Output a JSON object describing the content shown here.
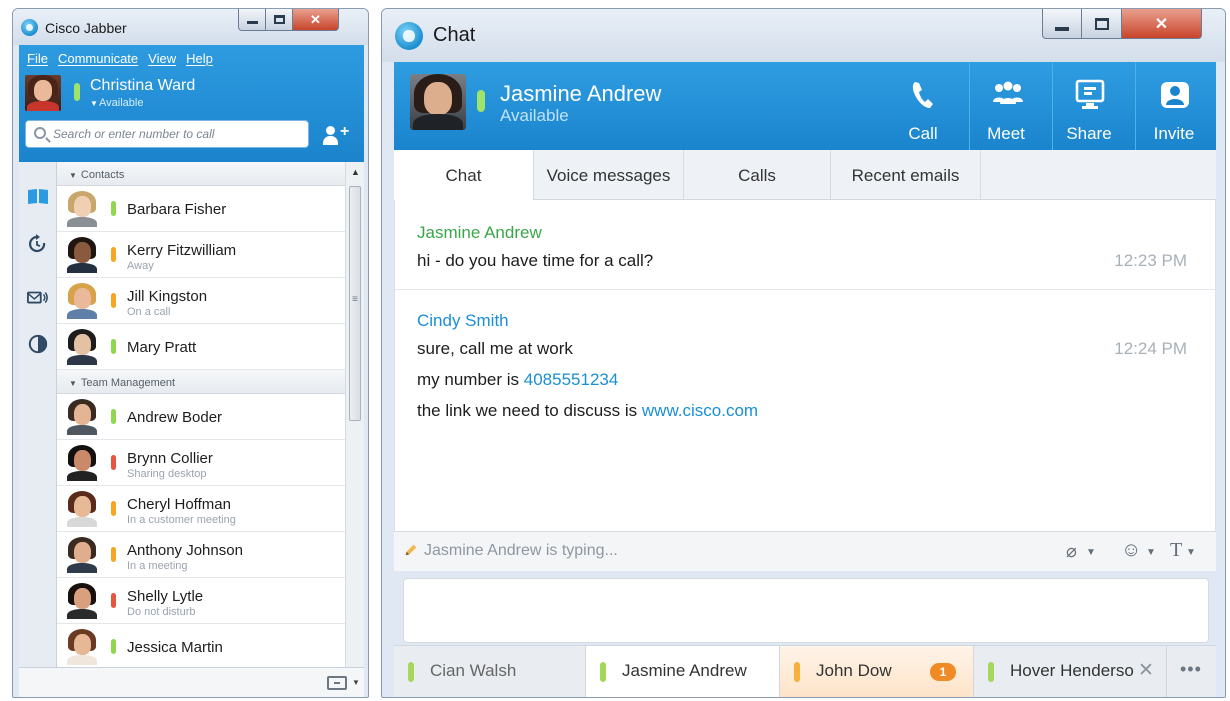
{
  "hub": {
    "title": "Cisco Jabber",
    "menu": [
      "File",
      "Communicate",
      "View",
      "Help"
    ],
    "user": {
      "name": "Christina Ward",
      "presence": "Available"
    },
    "search": {
      "placeholder": "Search or enter number to call"
    },
    "groups": [
      {
        "name": "Contacts",
        "contacts": [
          {
            "name": "Barbara Fisher",
            "status": "",
            "color": "#8fd84e"
          },
          {
            "name": "Kerry Fitzwilliam",
            "status": "Away",
            "color": "#f5a623"
          },
          {
            "name": "Jill Kingston",
            "status": "On a call",
            "color": "#f5a623"
          },
          {
            "name": "Mary Pratt",
            "status": "",
            "color": "#8fd84e"
          }
        ]
      },
      {
        "name": "Team Management",
        "contacts": [
          {
            "name": "Andrew Boder",
            "status": "",
            "color": "#8fd84e"
          },
          {
            "name": "Brynn Collier",
            "status": "Sharing desktop",
            "color": "#e8553e"
          },
          {
            "name": "Cheryl Hoffman",
            "status": "In a customer meeting",
            "color": "#f5a623"
          },
          {
            "name": "Anthony Johnson",
            "status": "In a meeting",
            "color": "#f5a623"
          },
          {
            "name": "Shelly Lytle",
            "status": "Do not disturb",
            "color": "#e8553e"
          },
          {
            "name": "Jessica Martin",
            "status": "",
            "color": "#8fd84e"
          }
        ]
      }
    ],
    "rail_icons": [
      "contacts-book-icon",
      "recents-icon",
      "voicemail-icon",
      "custom-tab-icon"
    ]
  },
  "chat": {
    "title": "Chat",
    "peer": {
      "name": "Jasmine Andrew",
      "presence": "Available"
    },
    "actions": [
      "Call",
      "Meet",
      "Share",
      "Invite"
    ],
    "tabs": [
      "Chat",
      "Voice messages",
      "Calls",
      "Recent emails"
    ],
    "messages": [
      {
        "sender": "Jasmine Andrew",
        "sender_color": "#3aa64a",
        "time": "12:23 PM",
        "lines": [
          "hi - do you have time for a call?"
        ]
      },
      {
        "sender": "Cindy Smith",
        "sender_color": "#1a8fd4",
        "time": "12:24 PM",
        "lines": [
          "sure, call me at work"
        ],
        "number_line_prefix": "my number is",
        "number": "4085551234",
        "link_line_prefix": "the link we need to discuss is",
        "link": "www.cisco.com"
      }
    ],
    "typing": "Jasmine Andrew is typing...",
    "conversations": [
      {
        "name": "Cian Walsh",
        "color": "#a5d85a"
      },
      {
        "name": "Jasmine Andrew",
        "color": "#a5d85a"
      },
      {
        "name": "John Dow",
        "color": "#f5b13a",
        "badge": "1"
      },
      {
        "name": "Hover Henderso",
        "color": "#a5d85a"
      }
    ],
    "more": "•••"
  }
}
